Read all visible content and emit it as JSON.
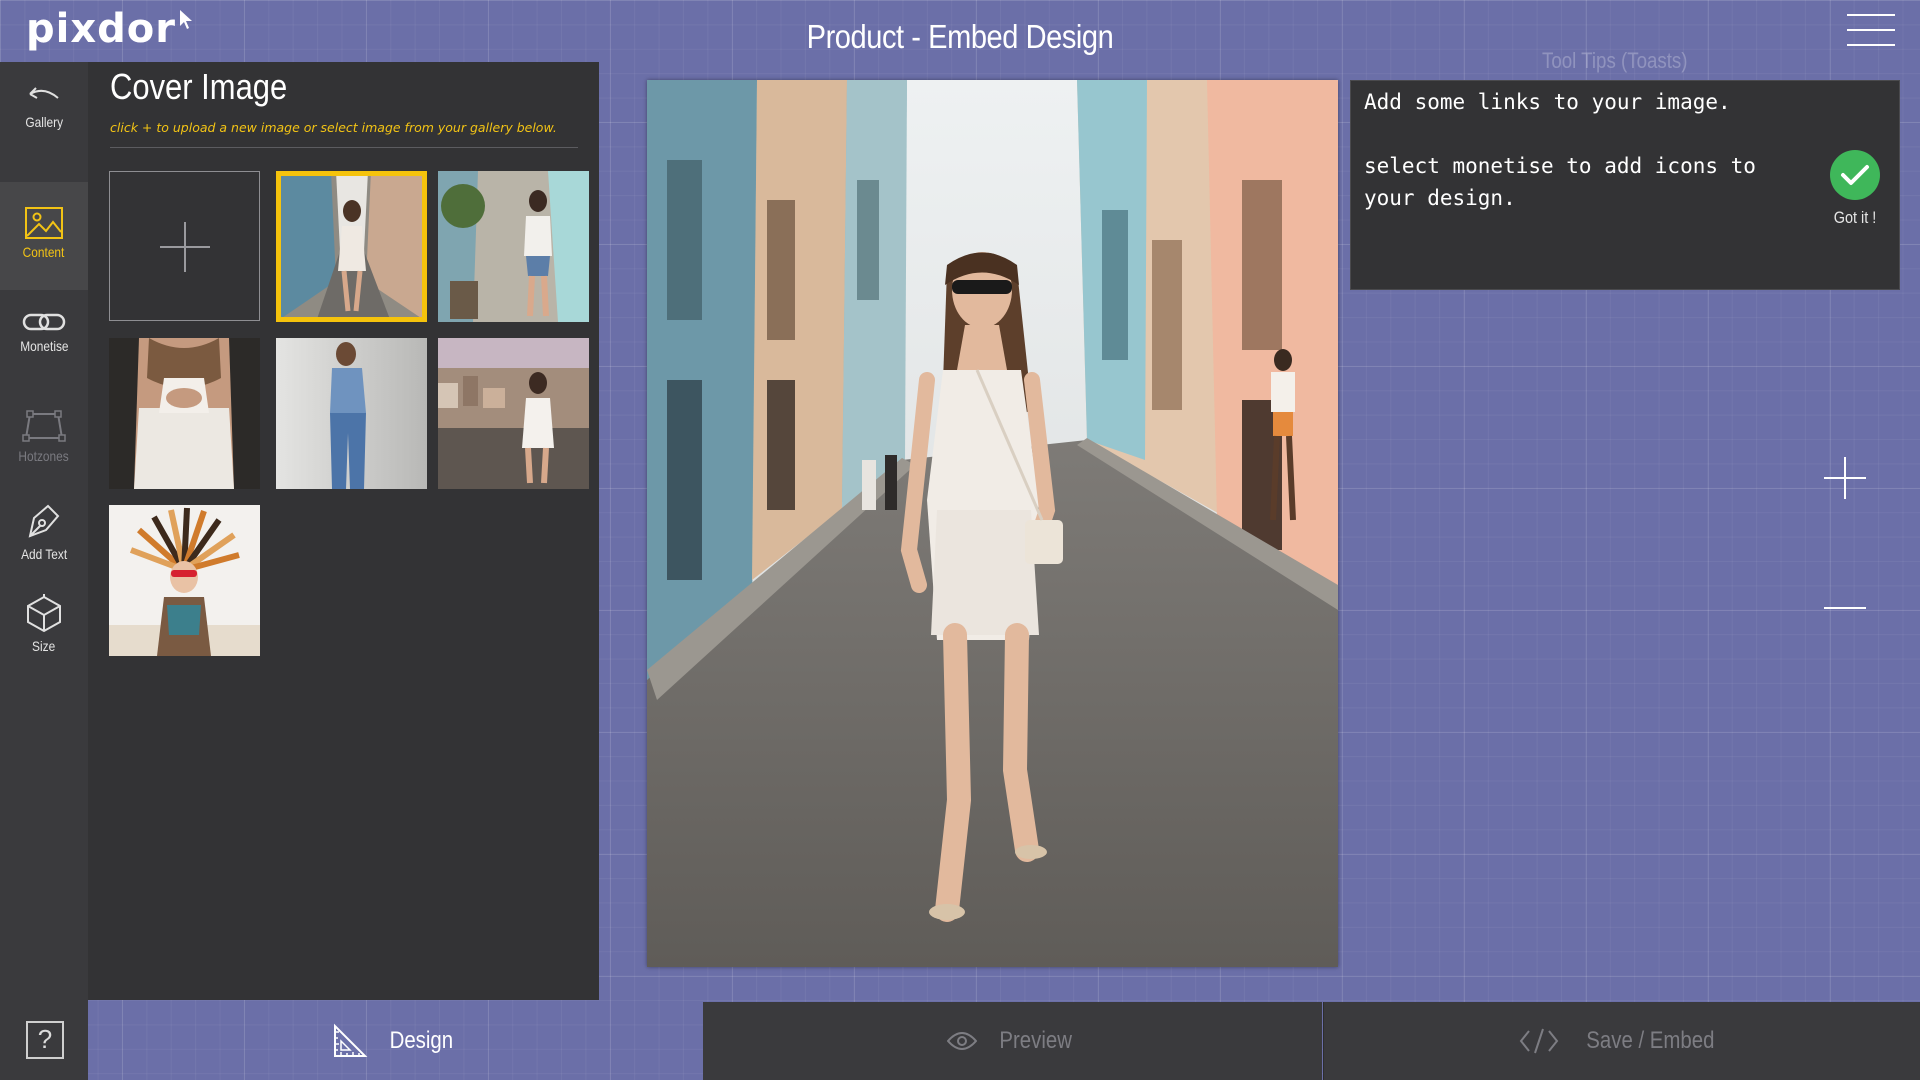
{
  "app": {
    "logo": "pixdor",
    "title": "Product - Embed Design",
    "menu_icon": "hamburger-menu-icon"
  },
  "rail": {
    "items": [
      {
        "label": "Gallery",
        "icon": "back-arrow-icon",
        "state": "normal"
      },
      {
        "label": "Content",
        "icon": "image-icon",
        "state": "active"
      },
      {
        "label": "Monetise",
        "icon": "link-icon",
        "state": "normal"
      },
      {
        "label": "Hotzones",
        "icon": "hotzone-icon",
        "state": "disabled"
      },
      {
        "label": "Add Text",
        "icon": "pen-icon",
        "state": "normal"
      },
      {
        "label": "Size",
        "icon": "cube-icon",
        "state": "normal"
      }
    ],
    "help_label": "?"
  },
  "panel": {
    "title": "Cover Image",
    "hint": "click + to upload a new image or select image from your gallery below.",
    "upload_icon": "plus-icon",
    "thumbnails": [
      {
        "subject": "woman walking in street, white romper",
        "selected": true
      },
      {
        "subject": "woman in denim shorts on street",
        "selected": false
      },
      {
        "subject": "back of white lace top",
        "selected": false
      },
      {
        "subject": "woman in denim overalls",
        "selected": false
      },
      {
        "subject": "woman on balcony over city",
        "selected": false
      },
      {
        "subject": "woman with feather headdress",
        "selected": false
      }
    ]
  },
  "tooltip": {
    "section_label": "Tool Tips (Toasts)",
    "line1": "Add some links to your image.",
    "line2": "select monetise to add icons to your design.",
    "confirm_label": "Got it !"
  },
  "tabs": [
    {
      "label": "Design",
      "icon": "design-ruler-icon",
      "active": true
    },
    {
      "label": "Preview",
      "icon": "eye-icon",
      "active": false
    },
    {
      "label": "Save / Embed",
      "icon": "code-icon",
      "active": false
    }
  ],
  "colors": {
    "background": "#6b6fa8",
    "panel": "#333335",
    "accent": "#f2c315",
    "confirm": "#3fb75a"
  }
}
